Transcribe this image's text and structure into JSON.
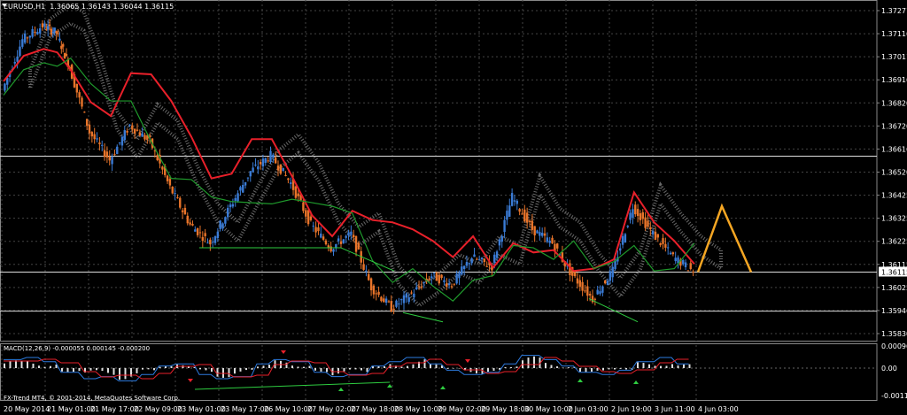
{
  "chart": {
    "symbol_title": "EURUSD,H1  1.36065 1.36143 1.36044 1.36115",
    "macd_title": "MACD(12,26,9) -0.000055 0.000145 -0.000200",
    "copyright": "FX-Trend MT4, © 2001-2014, MetaQuotes Software Corp.",
    "current_price": "1.36115"
  },
  "chart_data": {
    "type": "candlestick",
    "price_axis_labels": [
      "1.37271",
      "1.37116",
      "1.37011",
      "1.36916",
      "1.36820",
      "1.36720",
      "1.36616",
      "1.36520",
      "1.36425",
      "1.36325",
      "1.36225",
      "1.36115",
      "1.36025",
      "1.35946",
      "1.35830"
    ],
    "macd_axis_labels": [
      "0.000969",
      "0.00",
      "-0.001107"
    ],
    "time_axis_labels": [
      "20 May 2014",
      "21 May 01:00",
      "21 May 17:00",
      "22 May 09:00",
      "23 May 01:00",
      "23 May 17:00",
      "26 May 10:00",
      "27 May 02:00",
      "27 May 18:00",
      "28 May 10:00",
      "29 May 02:00",
      "29 May 18:00",
      "30 May 10:00",
      "2 Jun 03:00",
      "2 Jun 19:00",
      "3 Jun 11:00",
      "4 Jun 03:00"
    ],
    "ylim": [
      1.3583,
      1.3728
    ],
    "current_price": 1.36115,
    "horizontal_levels": [
      1.36616,
      1.36115,
      1.35946
    ],
    "price_path": [
      [
        0,
        1.369
      ],
      [
        6,
        1.3712
      ],
      [
        12,
        1.3718
      ],
      [
        16,
        1.3715
      ],
      [
        20,
        1.37
      ],
      [
        26,
        1.3672
      ],
      [
        32,
        1.366
      ],
      [
        38,
        1.3675
      ],
      [
        44,
        1.3668
      ],
      [
        50,
        1.3648
      ],
      [
        56,
        1.3632
      ],
      [
        62,
        1.3624
      ],
      [
        68,
        1.364
      ],
      [
        74,
        1.3655
      ],
      [
        80,
        1.3662
      ],
      [
        86,
        1.365
      ],
      [
        92,
        1.3632
      ],
      [
        98,
        1.3622
      ],
      [
        104,
        1.3628
      ],
      [
        110,
        1.3605
      ],
      [
        116,
        1.3596
      ],
      [
        122,
        1.3602
      ],
      [
        128,
        1.361
      ],
      [
        134,
        1.3606
      ],
      [
        140,
        1.3618
      ],
      [
        146,
        1.3614
      ],
      [
        152,
        1.3644
      ],
      [
        158,
        1.363
      ],
      [
        164,
        1.3624
      ],
      [
        170,
        1.361
      ],
      [
        176,
        1.36
      ],
      [
        182,
        1.3612
      ],
      [
        188,
        1.364
      ],
      [
        194,
        1.3628
      ],
      [
        200,
        1.3618
      ],
      [
        206,
        1.3612
      ]
    ],
    "projection": [
      [
        206,
        1.36115
      ],
      [
        212,
        1.364
      ],
      [
        218,
        1.36115
      ]
    ],
    "macd_hist": [
      0.4,
      0.5,
      0.3,
      -0.2,
      -0.5,
      -0.4,
      -0.6,
      -0.3,
      0.1,
      0.2,
      -0.3,
      -0.5,
      -0.4,
      0.2,
      0.4,
      0.3,
      -0.2,
      -0.4,
      -0.3,
      0.1,
      0.3,
      0.5,
      0.2,
      -0.1,
      -0.3,
      -0.2,
      0.2,
      0.6,
      0.4,
      0.1,
      -0.2,
      -0.3,
      -0.1,
      0.3,
      0.5,
      0.2
    ],
    "grid": true
  }
}
